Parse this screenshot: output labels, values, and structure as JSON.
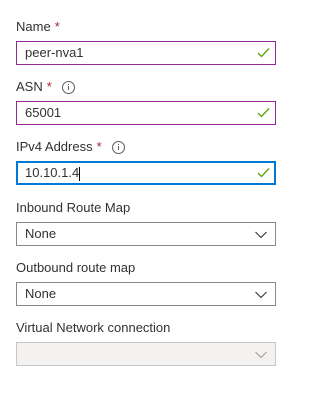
{
  "form": {
    "name": {
      "label": "Name",
      "required": "*",
      "value": "peer-nva1"
    },
    "asn": {
      "label": "ASN",
      "required": "*",
      "value": "65001"
    },
    "ipv4": {
      "label": "IPv4 Address",
      "required": "*",
      "value": "10.10.1.4"
    },
    "inbound": {
      "label": "Inbound Route Map",
      "value": "None"
    },
    "outbound": {
      "label": "Outbound route map",
      "value": "None"
    },
    "vnet": {
      "label": "Virtual Network connection",
      "value": ""
    }
  },
  "colors": {
    "valid_border": "#8d2a93",
    "focus_border": "#0078d4",
    "check_green": "#57a300",
    "required_red": "#a4262c"
  },
  "icons": {
    "valid": "checkmark-icon",
    "info": "info-icon",
    "dropdown": "chevron-down-icon"
  }
}
